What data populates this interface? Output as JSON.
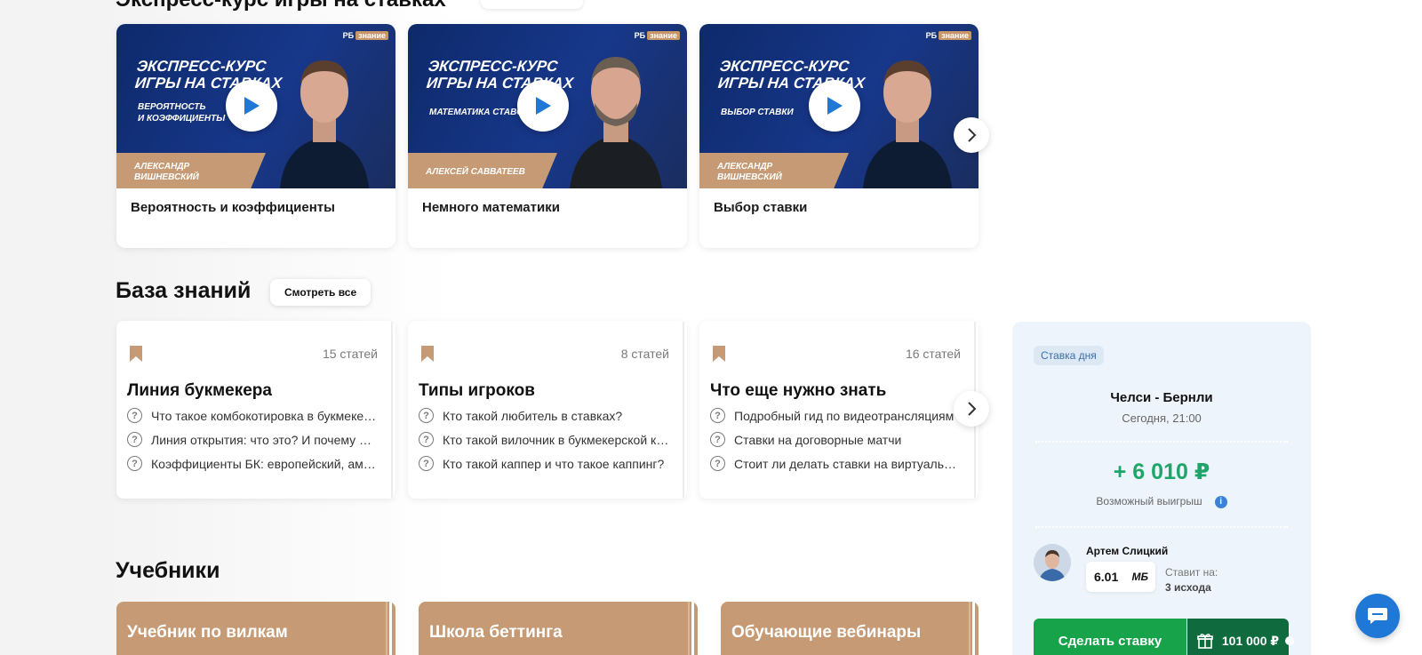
{
  "express_course": {
    "section_title": "Экспресс-курс игры на ставках",
    "cards": [
      {
        "thumb_title": "ЭКСПРЕСС-КУРС ИГРЫ НА СТАВКАХ",
        "thumb_line1": "ЭКСПРЕСС-КУРС",
        "thumb_line2": "ИГРЫ НА СТАВКАХ",
        "thumb_sub1": "ВЕРОЯТНОСТЬ",
        "thumb_sub2": "И КОЭФФИЦИЕНТЫ",
        "author1": "АЛЕКСАНДР",
        "author2": "ВИШНЕВСКИЙ",
        "label": "Вероятность и коэффициенты"
      },
      {
        "thumb_line1": "ЭКСПРЕСС-КУРС",
        "thumb_line2": "ИГРЫ НА СТАВКАХ",
        "thumb_sub1": "МАТЕМАТИКА СТАВОК",
        "thumb_sub2": "",
        "author1": "АЛЕКСЕЙ САВВАТЕЕВ",
        "author2": "",
        "label": "Немного математики"
      },
      {
        "thumb_line1": "ЭКСПРЕСС-КУРС",
        "thumb_line2": "ИГРЫ НА СТАВКАХ",
        "thumb_sub1": "ВЫБОР СТАВКИ",
        "thumb_sub2": "",
        "author1": "АЛЕКСАНДР",
        "author2": "ВИШНЕВСКИЙ",
        "label": "Выбор ставки"
      }
    ],
    "brand_logo": "РБ",
    "brand_tag": "знание"
  },
  "knowledge_base": {
    "title": "База знаний",
    "see_all": "Смотреть все",
    "cards": [
      {
        "count": "15 статей",
        "title": "Линия букмекера",
        "questions": [
          "Что такое комбокотировка в букмекерской конторе?",
          "Линия открытия: что это? И почему она важна?",
          "Коэффициенты БК: европейский, американский"
        ]
      },
      {
        "count": "8 статей",
        "title": "Типы игроков",
        "questions": [
          "Кто такой любитель в ставках?",
          "Кто такой вилочник в букмекерской конторе?",
          "Кто такой каппер и что такое каппинг?"
        ]
      },
      {
        "count": "16 статей",
        "title": "Что еще нужно знать",
        "questions": [
          "Подробный гид по видеотрансляциям",
          "Ставки на договорные матчи",
          "Стоит ли делать ставки на виртуальный спорт?"
        ]
      }
    ]
  },
  "textbooks": {
    "title": "Учебники",
    "items": [
      "Учебник по вилкам",
      "Школа беттинга",
      "Обучающие вебинары"
    ]
  },
  "bet_of_day": {
    "tag": "Ставка дня",
    "match": "Челси - Бернли",
    "time": "Сегодня, 21:00",
    "win_amount": "+ 6 010 ₽",
    "win_label": "Возможный выигрыш",
    "info_icon": "i",
    "expert_name": "Артем Слицкий",
    "coef": "6.01",
    "bookmaker": "МБ",
    "stake_label": "Ставит на:",
    "stake_value": "3 исхода",
    "make_bet": "Сделать ставку",
    "bonus": "101 000 ₽"
  },
  "colors": {
    "accent_green": "#17a34a",
    "win_green": "#1ea66a",
    "dark_green": "#0f6b3e",
    "tan": "#c69a74",
    "blue": "#1f78d6"
  }
}
